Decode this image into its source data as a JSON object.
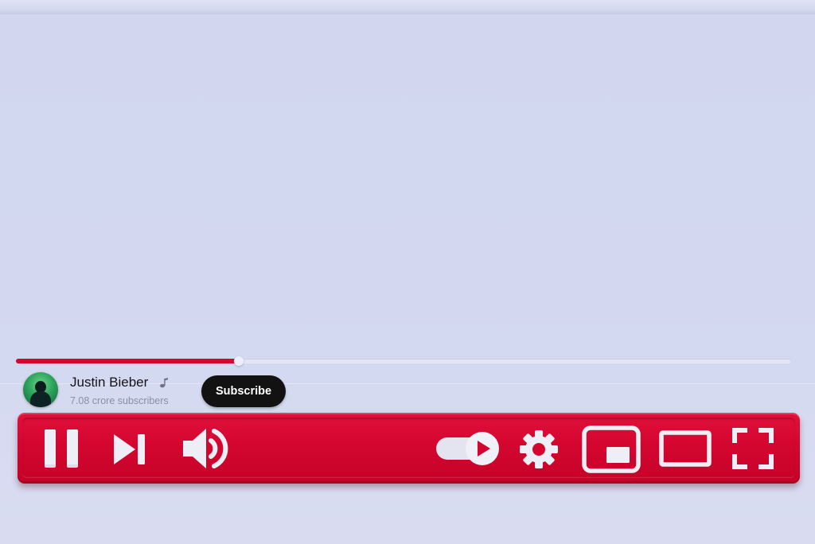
{
  "player": {
    "progress_fraction": 0.287,
    "progress_color": "#d8062f",
    "control_bar_color": "#d4062f",
    "icon_color": "#e9e9f4"
  },
  "channel": {
    "name": "Justin Bieber",
    "badge_icon": "music-note-icon",
    "subscribers": "7.08 crore subscribers",
    "avatar_icon": "avatar-image"
  },
  "subscribe": {
    "label": "Subscribe"
  },
  "controls": {
    "left": [
      "pause-icon",
      "next-icon",
      "volume-icon"
    ],
    "right": [
      "autoplay-toggle-icon",
      "settings-gear-icon",
      "miniplayer-icon",
      "theater-mode-icon",
      "fullscreen-icon"
    ]
  }
}
